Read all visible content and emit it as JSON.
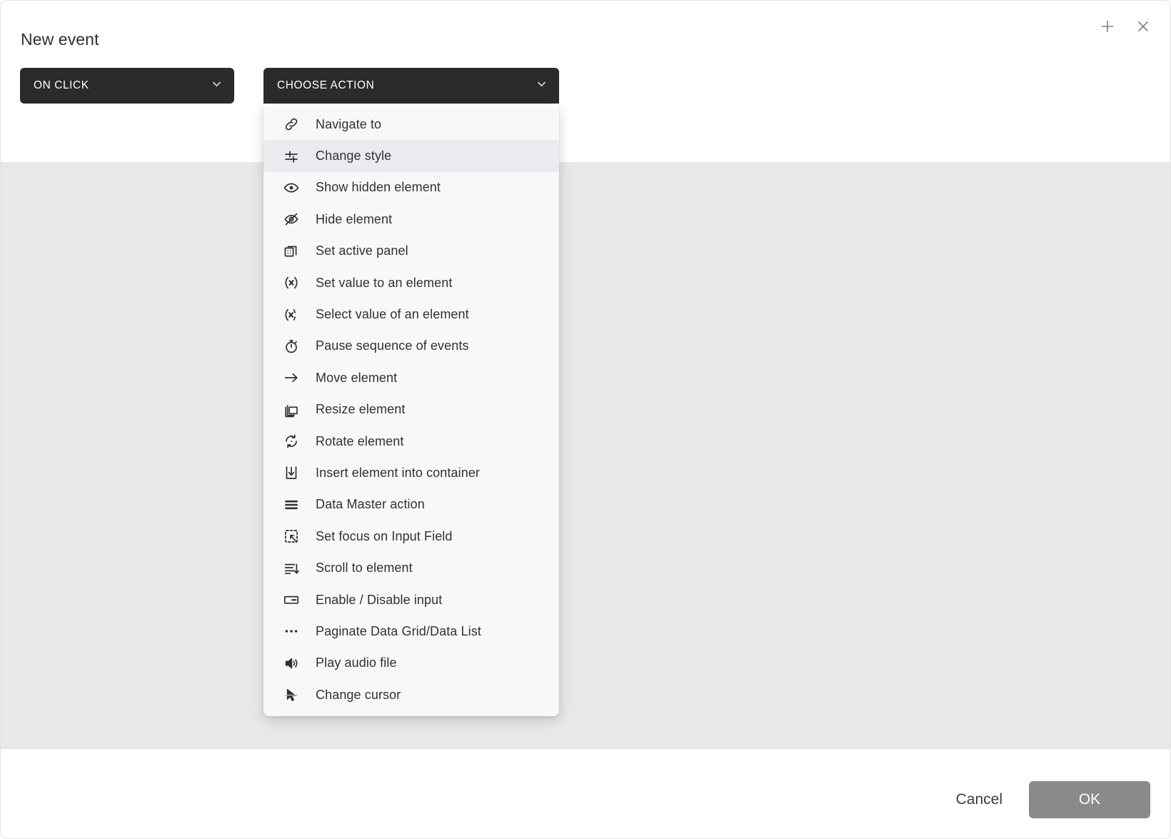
{
  "dialog": {
    "title": "New event",
    "window_controls": [
      {
        "name": "add-icon",
        "label": "+"
      },
      {
        "name": "close-icon",
        "label": "×"
      }
    ]
  },
  "selects": {
    "trigger": {
      "value": "ON CLICK",
      "chevron": "chevron-down-icon"
    },
    "action": {
      "value": "CHOOSE ACTION",
      "chevron": "chevron-down-icon"
    }
  },
  "menu": {
    "open": true,
    "highlighted_index": 1,
    "items": [
      {
        "label": "Navigate to",
        "icon": "link-icon"
      },
      {
        "label": "Change style",
        "icon": "sliders-icon"
      },
      {
        "label": "Show hidden element",
        "icon": "eye-icon"
      },
      {
        "label": "Hide element",
        "icon": "eye-off-icon"
      },
      {
        "label": "Set active panel",
        "icon": "panels-icon"
      },
      {
        "label": "Set value to an element",
        "icon": "set-value-icon"
      },
      {
        "label": "Select value of an element",
        "icon": "select-value-icon"
      },
      {
        "label": "Pause sequence of events",
        "icon": "stopwatch-icon"
      },
      {
        "label": "Move element",
        "icon": "arrow-right-icon"
      },
      {
        "label": "Resize element",
        "icon": "resize-icon"
      },
      {
        "label": "Rotate element",
        "icon": "rotate-icon"
      },
      {
        "label": "Insert element into container",
        "icon": "insert-down-icon"
      },
      {
        "label": "Data Master action",
        "icon": "data-master-icon"
      },
      {
        "label": "Set focus on Input Field",
        "icon": "focus-icon"
      },
      {
        "label": "Scroll to element",
        "icon": "scroll-down-icon"
      },
      {
        "label": "Enable / Disable input",
        "icon": "input-field-icon"
      },
      {
        "label": "Paginate Data Grid/Data List",
        "icon": "ellipsis-icon"
      },
      {
        "label": "Play audio file",
        "icon": "speaker-icon"
      },
      {
        "label": "Change cursor",
        "icon": "cursor-icon"
      }
    ]
  },
  "footer": {
    "cancel_label": "Cancel",
    "ok_label": "OK"
  },
  "colors": {
    "select_dark": "#2b2b2b",
    "body_gray": "#e8e8e8",
    "menu_bg": "#f7f8f9",
    "menu_highlight": "#e9ebee",
    "ok_button": "#8a8a8a",
    "text_primary": "#2f3235"
  }
}
